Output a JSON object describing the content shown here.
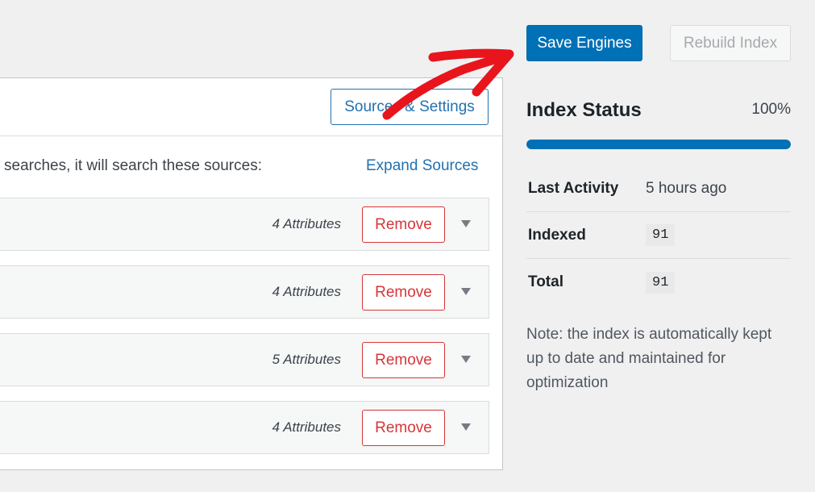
{
  "toolbar": {
    "save_label": "Save Engines",
    "rebuild_label": "Rebuild Index"
  },
  "engine": {
    "sources_settings_label": "Sources & Settings",
    "description": "searches, it will search these sources:",
    "expand_label": "Expand Sources",
    "sources": [
      {
        "attributes": "4 Attributes",
        "remove_label": "Remove"
      },
      {
        "attributes": "4 Attributes",
        "remove_label": "Remove"
      },
      {
        "attributes": "5 Attributes",
        "remove_label": "Remove"
      },
      {
        "attributes": "4 Attributes",
        "remove_label": "Remove"
      }
    ]
  },
  "index_status": {
    "title": "Index Status",
    "percent": "100%",
    "progress": 1.0,
    "rows": [
      {
        "label": "Last Activity",
        "value": "5 hours ago"
      },
      {
        "label": "Indexed",
        "value": "91"
      },
      {
        "label": "Total",
        "value": "91"
      }
    ],
    "note": "Note: the index is automatically kept up to date and maintained for optimization"
  },
  "colors": {
    "primary": "#0071b6",
    "danger": "#d63638",
    "link": "#2271b1",
    "annotation": "#e8151c"
  },
  "icons": {
    "caret": "caret-down-icon",
    "arrow": "annotation-arrow-icon"
  }
}
